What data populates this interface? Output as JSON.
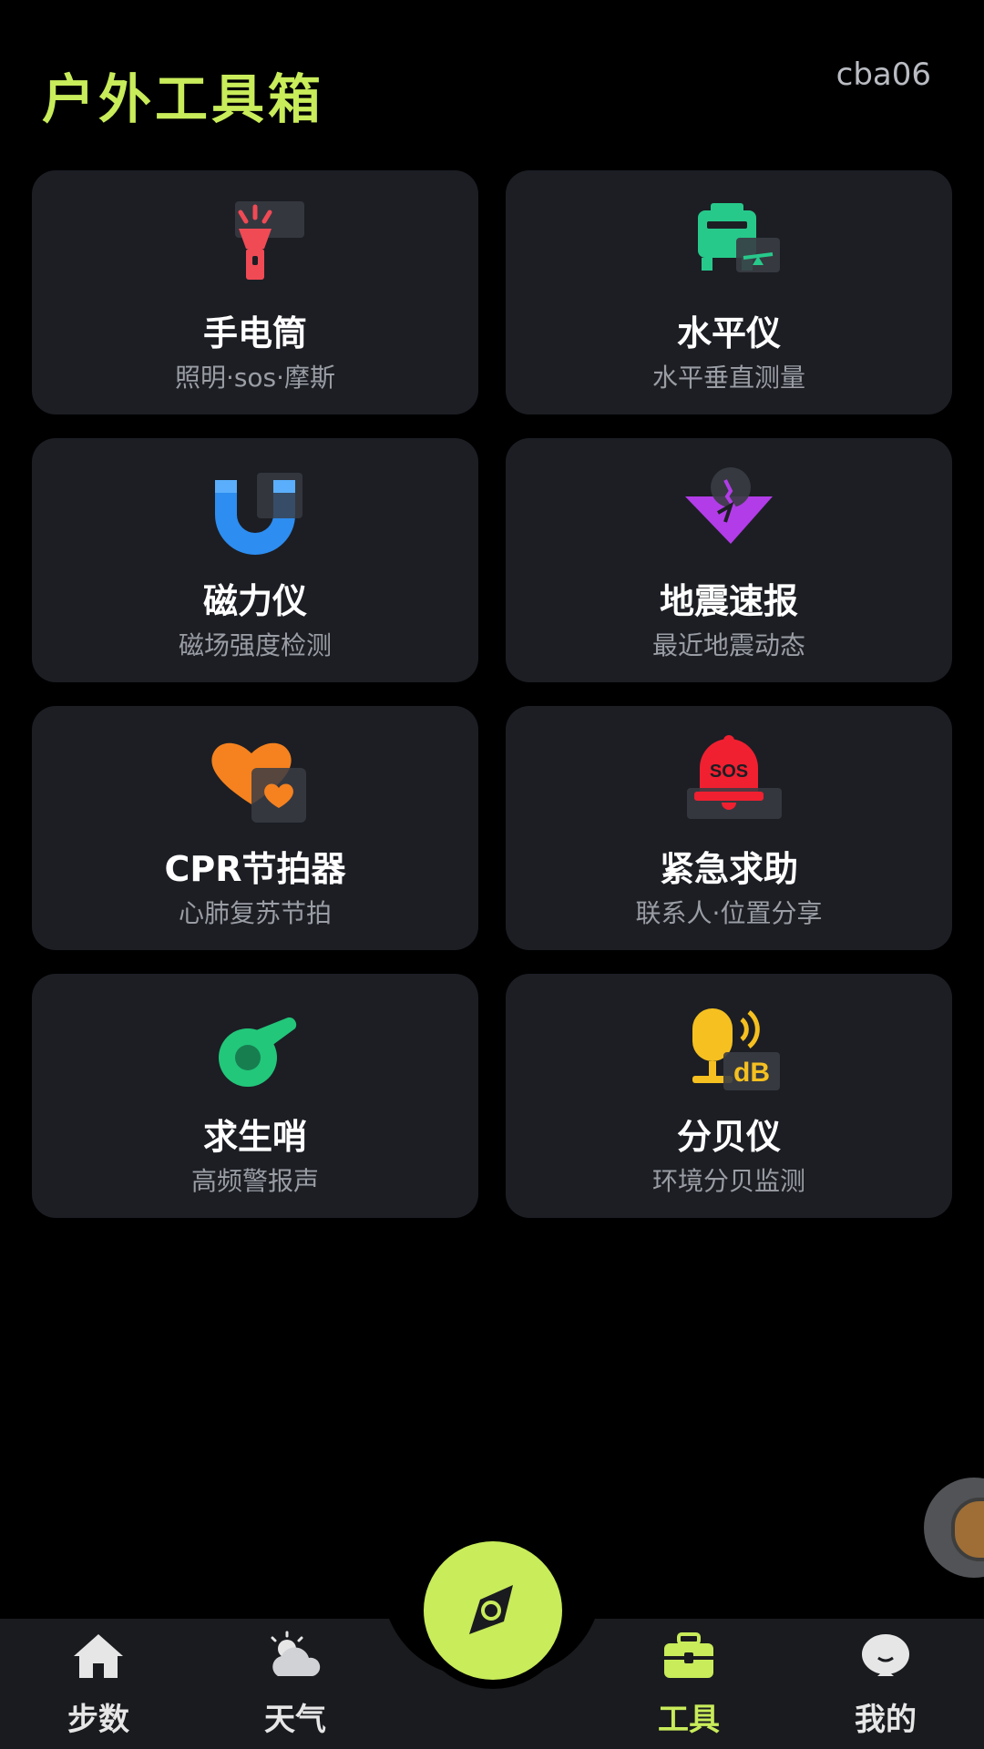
{
  "header": {
    "title": "户外工具箱",
    "user_id": "cba06"
  },
  "tools": [
    {
      "title": "手电筒",
      "subtitle": "照明·sos·摩斯",
      "icon": "flashlight-icon"
    },
    {
      "title": "水平仪",
      "subtitle": "水平垂直测量",
      "icon": "level-icon"
    },
    {
      "title": "磁力仪",
      "subtitle": "磁场强度检测",
      "icon": "magnet-icon"
    },
    {
      "title": "地震速报",
      "subtitle": "最近地震动态",
      "icon": "earthquake-icon"
    },
    {
      "title": "CPR节拍器",
      "subtitle": "心肺复苏节拍",
      "icon": "heart-icon"
    },
    {
      "title": "紧急求助",
      "subtitle": "联系人·位置分享",
      "icon": "sos-bell-icon",
      "badge": "SOS"
    },
    {
      "title": "求生哨",
      "subtitle": "高频警报声",
      "icon": "whistle-icon"
    },
    {
      "title": "分贝仪",
      "subtitle": "环境分贝监测",
      "icon": "decibel-meter-icon",
      "badge": "dB"
    }
  ],
  "nav": {
    "items": [
      {
        "label": "步数",
        "icon": "home-icon"
      },
      {
        "label": "天气",
        "icon": "weather-icon"
      },
      {
        "label": "工具",
        "icon": "toolbox-icon",
        "active": true
      },
      {
        "label": "我的",
        "icon": "profile-icon"
      }
    ],
    "center_icon": "compass-icon"
  },
  "colors": {
    "accent": "#c8ec5a",
    "card_bg": "#1c1e24",
    "background": "#000000"
  }
}
